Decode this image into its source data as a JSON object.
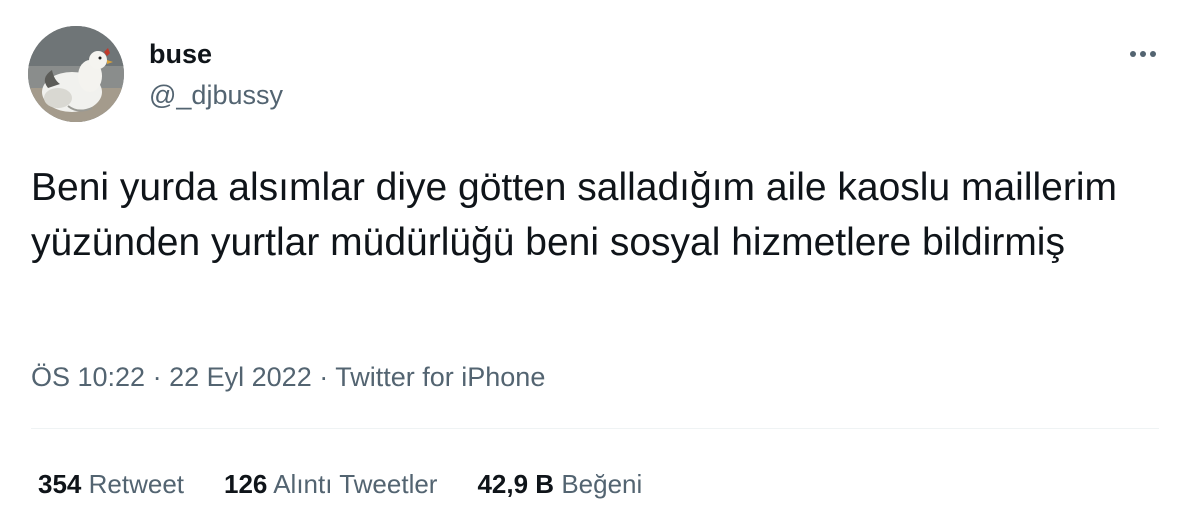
{
  "author": {
    "display_name": "buse",
    "handle": "@_djbussy"
  },
  "tweet": {
    "text": "Beni yurda alsımlar diye götten salladığım aile kaoslu maillerim yüzünden yurtlar müdürlüğü beni sosyal hizmetlere bildirmiş"
  },
  "meta": {
    "time": "ÖS 10:22",
    "date": "22 Eyl 2022",
    "source": "Twitter for iPhone",
    "separator": "·"
  },
  "stats": {
    "retweets": {
      "count": "354",
      "label": "Retweet"
    },
    "quotes": {
      "count": "126",
      "label": "Alıntı Tweetler"
    },
    "likes": {
      "count": "42,9 B",
      "label": "Beğeni"
    }
  },
  "icons": {
    "more": "more-horizontal-icon",
    "avatar": "chicken-photo"
  },
  "colors": {
    "text_primary": "#0f1419",
    "text_secondary": "#536471",
    "divider": "#eff3f4"
  }
}
